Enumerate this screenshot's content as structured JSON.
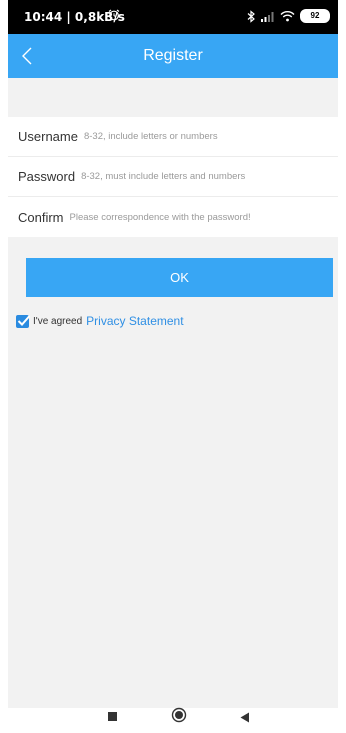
{
  "status_bar": {
    "time": "10:44 | 0,8kB/s",
    "alarm_icon": "alarm-clock-icon",
    "bluetooth_icon": "bluetooth-icon",
    "signal_icon": "signal-bars-icon",
    "wifi_icon": "wifi-icon",
    "battery_level": "92"
  },
  "app_bar": {
    "title": "Register",
    "back_icon": "chevron-left-icon",
    "color": "#38a6f4"
  },
  "form": {
    "username": {
      "label": "Username",
      "value": "",
      "placeholder": "8-32, include letters or numbers"
    },
    "password": {
      "label": "Password",
      "value": "",
      "placeholder": "8-32, must include letters and numbers"
    },
    "confirm": {
      "label": "Confirm",
      "value": "",
      "placeholder": "Please correspondence with the password!"
    }
  },
  "ok_button": {
    "label": "OK"
  },
  "agreement": {
    "checked": true,
    "text": "I've agreed",
    "link": "Privacy Statement"
  },
  "nav_bar": {
    "recents_icon": "square-icon",
    "home_icon": "circle-icon",
    "back_icon": "triangle-back-icon"
  }
}
